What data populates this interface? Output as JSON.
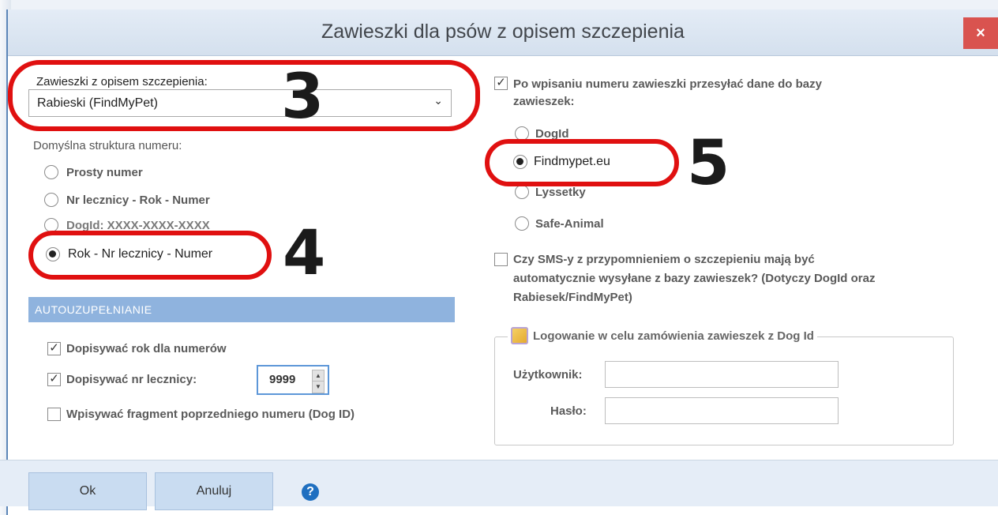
{
  "window": {
    "title": "Zawieszki dla psów z opisem szczepienia",
    "close": "×"
  },
  "left": {
    "tag_label": "Zawieszki z opisem szczepienia:",
    "tag_value": "Rabieski (FindMyPet)",
    "structure_label": "Domyślna struktura numeru:",
    "structure_options": [
      "Prosty numer",
      "Nr lecznicy - Rok - Numer",
      "DogId: XXXX-XXXX-XXXX",
      "Rok - Nr lecznicy - Numer"
    ],
    "structure_selected": "Rok - Nr lecznicy - Numer",
    "autofill_header": "AUTOUZUPEŁNIANIE",
    "append_year": {
      "label": "Dopisywać rok dla numerów",
      "checked": true
    },
    "append_clinic": {
      "label": "Dopisywać nr lecznicy:",
      "checked": true,
      "value": "9999"
    },
    "write_fragment": {
      "label": "Wpisywać fragment poprzedniego numeru (Dog ID)",
      "checked": false
    }
  },
  "right": {
    "send_data": {
      "label_line1": "Po wpisaniu numeru zawieszki przesyłać dane do bazy",
      "label_line2": "zawieszek:",
      "checked": true
    },
    "databases": [
      "DogId",
      "Findmypet.eu",
      "Lyssetky",
      "Safe-Animal"
    ],
    "database_selected": "Findmypet.eu",
    "sms": {
      "line1": "Czy SMS-y z przypomnieniem o szczepieniu mają być",
      "line2": "automatycznie wysyłane z bazy zawieszek? (Dotyczy DogId oraz",
      "line3": "Rabiesek/FindMyPet)",
      "checked": false
    },
    "login_group": {
      "title": "Logowanie w celu zamówienia zawieszek z Dog Id",
      "user_label": "Użytkownik:",
      "password_label": "Hasło:",
      "user_value": "",
      "password_value": ""
    }
  },
  "footer": {
    "ok": "Ok",
    "cancel": "Anuluj",
    "help": "?"
  },
  "callouts": [
    "3",
    "4",
    "5"
  ],
  "colors": {
    "callout": "#e01010",
    "section_bar": "#8fb3de",
    "close": "#d9534f"
  }
}
